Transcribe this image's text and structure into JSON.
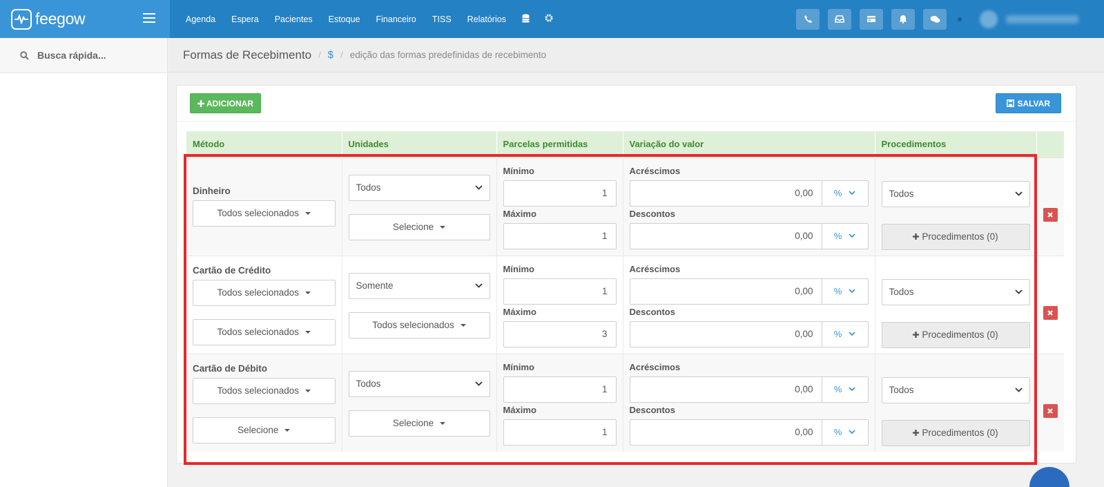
{
  "brand": {
    "name": "feegow"
  },
  "nav": {
    "items": [
      "Agenda",
      "Espera",
      "Pacientes",
      "Estoque",
      "Financeiro",
      "TISS",
      "Relatórios"
    ],
    "icons": [
      "database-icon",
      "gear-icon"
    ],
    "right_icons": [
      "phone-icon",
      "inbox-icon",
      "card-icon",
      "bell-icon",
      "chat-icon"
    ]
  },
  "sidebar": {
    "search_label": "Busca rápida..."
  },
  "header": {
    "title": "Formas de Recebimento",
    "crumb_icon": "$",
    "crumb_text": "edição das formas predefinidas de recebimento"
  },
  "toolbar": {
    "add_label": "ADICIONAR",
    "save_label": "SALVAR"
  },
  "table": {
    "headers": [
      "Método",
      "Unidades",
      "Parcelas permitidas",
      "Variação do valor",
      "Procedimentos"
    ],
    "min_label": "Mínimo",
    "max_label": "Máximo",
    "add_label": "Acréscimos",
    "disc_label": "Descontos",
    "unit_symbol": "%",
    "rows": [
      {
        "method": "Dinheiro",
        "method_dd1": "Todos selecionados",
        "method_dd2": "",
        "units_select": "Todos",
        "units_dd": "Selecione",
        "min": "1",
        "max": "1",
        "acrescimo": "0,00",
        "desconto": "0,00",
        "proc_select": "Todos",
        "proc_button": "Procedimentos (0)"
      },
      {
        "method": "Cartão de Crédito",
        "method_dd1": "Todos selecionados",
        "method_dd2": "Todos selecionados",
        "units_select": "Somente",
        "units_dd": "Todos selecionados",
        "min": "1",
        "max": "3",
        "acrescimo": "0,00",
        "desconto": "0,00",
        "proc_select": "Todos",
        "proc_button": "Procedimentos (0)"
      },
      {
        "method": "Cartão de Débito",
        "method_dd1": "Todos selecionados",
        "method_dd2": "Selecione",
        "units_select": "Todos",
        "units_dd": "Selecione",
        "min": "1",
        "max": "1",
        "acrescimo": "0,00",
        "desconto": "0,00",
        "proc_select": "Todos",
        "proc_button": "Procedimentos (0)"
      }
    ]
  },
  "colors": {
    "navbar": "#2481c4",
    "brand": "#3a95d8",
    "add": "#5cb85c",
    "save": "#3a95d8",
    "delete": "#d9534f",
    "highlight": "#e8282b",
    "header_bg": "#dff0d8"
  }
}
